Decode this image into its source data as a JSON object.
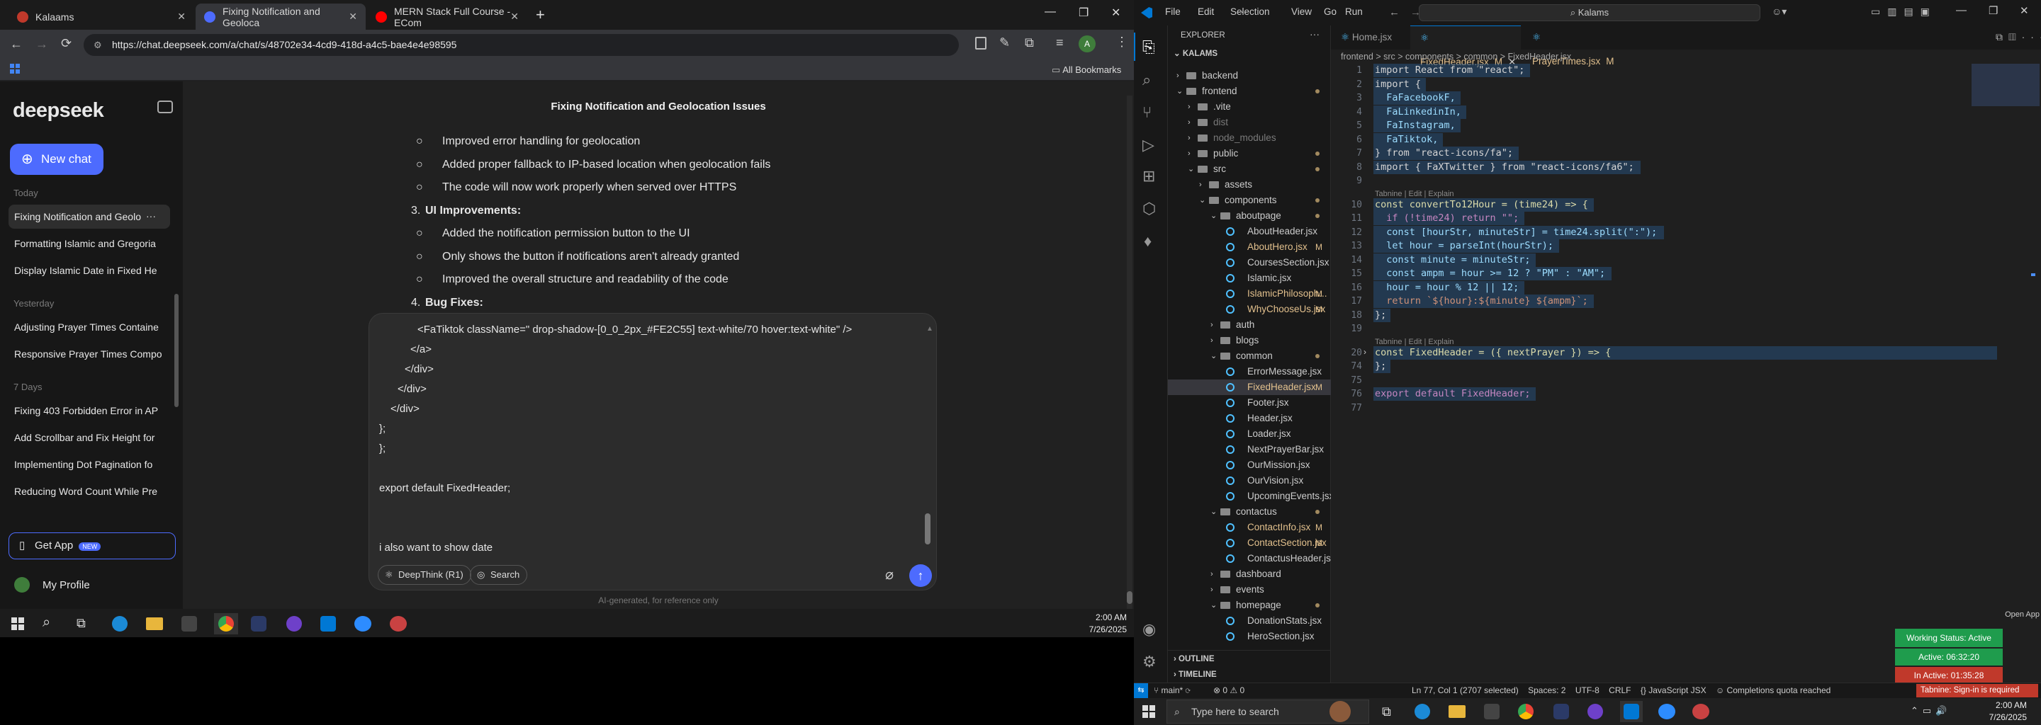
{
  "browser": {
    "tabs": [
      {
        "title": "Kalaams",
        "color": "#c0392b"
      },
      {
        "title": "Fixing Notification and Geoloca",
        "color": "#4d6bfe"
      },
      {
        "title": "MERN Stack Full Course - ECom",
        "color": "#ff0000"
      }
    ],
    "url": "https://chat.deepseek.com/a/chat/s/48702e34-4cd9-418d-a4c5-bae4e4e98595",
    "bookmarks_label": "All Bookmarks"
  },
  "deepseek": {
    "logo": "deepseek",
    "new_chat": "New chat",
    "groups": [
      {
        "label": "Today",
        "items": [
          "Fixing Notification and Geolo",
          "Formatting Islamic and Gregoria",
          "Display Islamic Date in Fixed He"
        ]
      },
      {
        "label": "Yesterday",
        "items": [
          "Adjusting Prayer Times Containe",
          "Responsive Prayer Times Compo"
        ]
      },
      {
        "label": "7 Days",
        "items": [
          "Fixing 403 Forbidden Error in AP",
          "Add Scrollbar and Fix Height for",
          "Implementing Dot Pagination fo",
          "Reducing Word Count While Pre"
        ]
      }
    ],
    "get_app": "Get App",
    "new_badge": "NEW",
    "profile": "My Profile",
    "chat_title": "Fixing Notification and Geolocation Issues",
    "message_lines": [
      {
        "type": "bullet",
        "text": "Improved error handling for geolocation"
      },
      {
        "type": "bullet",
        "text": "Added proper fallback to IP-based location when geolocation fails"
      },
      {
        "type": "bullet",
        "text": "The code will now work properly when served over HTTPS"
      },
      {
        "type": "num",
        "num": "3.",
        "text": "UI Improvements:"
      },
      {
        "type": "bullet",
        "text": "Added the notification permission button to the UI"
      },
      {
        "type": "bullet",
        "text": "Only shows the button if notifications aren't already granted"
      },
      {
        "type": "bullet",
        "text": "Improved the overall structure and readability of the code"
      },
      {
        "type": "num",
        "num": "4.",
        "text": "Bug Fixes:"
      }
    ],
    "input_lines": [
      "<FaTiktok className=\" drop-shadow-[0_0_2px_#FE2C55] text-white/70 hover:text-white\" />",
      "</a>",
      "</div>",
      "</div>",
      "</div>",
      "};",
      "};",
      "",
      "export default FixedHeader;",
      "",
      "",
      "i also want to show date"
    ],
    "deepthink": "DeepThink (R1)",
    "search": "Search",
    "disclaimer": "AI-generated, for reference only"
  },
  "taskbar1": {
    "time": "2:00 AM",
    "date": "7/26/2025"
  },
  "vscode": {
    "menu": [
      "File",
      "Edit",
      "Selection",
      "View",
      "Go",
      "Run"
    ],
    "search": "Kalams",
    "explorer_title": "EXPLORER",
    "root": "KALAMS",
    "tree": [
      {
        "name": "backend",
        "kind": "folder-closed",
        "depth": 0
      },
      {
        "name": "frontend",
        "kind": "folder-open",
        "depth": 0,
        "dot": true
      },
      {
        "name": ".vite",
        "kind": "folder-closed",
        "depth": 1
      },
      {
        "name": "dist",
        "kind": "folder-closed",
        "depth": 1,
        "dim": true
      },
      {
        "name": "node_modules",
        "kind": "folder-closed",
        "depth": 1,
        "dim": true
      },
      {
        "name": "public",
        "kind": "folder-closed",
        "depth": 1,
        "dot": true
      },
      {
        "name": "src",
        "kind": "folder-open",
        "depth": 1,
        "dot": true
      },
      {
        "name": "assets",
        "kind": "folder-closed",
        "depth": 2
      },
      {
        "name": "components",
        "kind": "folder-open",
        "depth": 2,
        "dot": true
      },
      {
        "name": "aboutpage",
        "kind": "folder-open",
        "depth": 3,
        "dot": true
      },
      {
        "name": "AboutHeader.jsx",
        "kind": "file",
        "depth": 4
      },
      {
        "name": "AboutHero.jsx",
        "kind": "file",
        "depth": 4,
        "badge": "M"
      },
      {
        "name": "CoursesSection.jsx",
        "kind": "file",
        "depth": 4
      },
      {
        "name": "Islamic.jsx",
        "kind": "file",
        "depth": 4
      },
      {
        "name": "IslamicPhilosoph...",
        "kind": "file",
        "depth": 4,
        "badge": "M"
      },
      {
        "name": "WhyChooseUs.jsx",
        "kind": "file",
        "depth": 4,
        "badge": "M"
      },
      {
        "name": "auth",
        "kind": "folder-closed",
        "depth": 3
      },
      {
        "name": "blogs",
        "kind": "folder-closed",
        "depth": 3
      },
      {
        "name": "common",
        "kind": "folder-open",
        "depth": 3,
        "dot": true
      },
      {
        "name": "ErrorMessage.jsx",
        "kind": "file",
        "depth": 4
      },
      {
        "name": "FixedHeader.jsx",
        "kind": "file",
        "depth": 4,
        "badge": "M",
        "selected": true
      },
      {
        "name": "Footer.jsx",
        "kind": "file",
        "depth": 4
      },
      {
        "name": "Header.jsx",
        "kind": "file",
        "depth": 4
      },
      {
        "name": "Loader.jsx",
        "kind": "file",
        "depth": 4
      },
      {
        "name": "NextPrayerBar.jsx",
        "kind": "file",
        "depth": 4
      },
      {
        "name": "OurMission.jsx",
        "kind": "file",
        "depth": 4
      },
      {
        "name": "OurVision.jsx",
        "kind": "file",
        "depth": 4
      },
      {
        "name": "UpcomingEvents.jsx",
        "kind": "file",
        "depth": 4
      },
      {
        "name": "contactus",
        "kind": "folder-open",
        "depth": 3,
        "dot": true
      },
      {
        "name": "ContactInfo.jsx",
        "kind": "file",
        "depth": 4,
        "badge": "M"
      },
      {
        "name": "ContactSection.jsx",
        "kind": "file",
        "depth": 4,
        "badge": "M"
      },
      {
        "name": "ContactusHeader.jsx",
        "kind": "file",
        "depth": 4
      },
      {
        "name": "dashboard",
        "kind": "folder-closed",
        "depth": 3
      },
      {
        "name": "events",
        "kind": "folder-closed",
        "depth": 3
      },
      {
        "name": "homepage",
        "kind": "folder-open",
        "depth": 3,
        "dot": true
      },
      {
        "name": "DonationStats.jsx",
        "kind": "file",
        "depth": 4
      },
      {
        "name": "HeroSection.jsx",
        "kind": "file",
        "depth": 4
      }
    ],
    "outline": "OUTLINE",
    "timeline": "TIMELINE",
    "editor_tabs": [
      {
        "name": "Home.jsx",
        "active": false
      },
      {
        "name": "FixedHeader.jsx",
        "active": true,
        "badge": "M"
      },
      {
        "name": "PrayerTimes.jsx",
        "active": false,
        "badge": "M"
      }
    ],
    "breadcrumb": "frontend > src > components > common > FixedHeader.jsx",
    "code": [
      {
        "n": "1",
        "t": "import React from \"react\";",
        "c": "#d4d4d4"
      },
      {
        "n": "2",
        "t": "import {",
        "c": "#d4d4d4"
      },
      {
        "n": "3",
        "t": "  FaFacebookF,",
        "c": "#9cdcfe"
      },
      {
        "n": "4",
        "t": "  FaLinkedinIn,",
        "c": "#9cdcfe"
      },
      {
        "n": "5",
        "t": "  FaInstagram,",
        "c": "#9cdcfe"
      },
      {
        "n": "6",
        "t": "  FaTiktok,",
        "c": "#9cdcfe"
      },
      {
        "n": "7",
        "t": "} from \"react-icons/fa\";",
        "c": "#d4d4d4"
      },
      {
        "n": "8",
        "t": "import { FaXTwitter } from \"react-icons/fa6\";",
        "c": "#d4d4d4"
      },
      {
        "n": "9",
        "t": "",
        "c": "#d4d4d4"
      },
      {
        "n": "",
        "t": "Tabnine | Edit | Explain",
        "c": "#8b8b8b",
        "lens": true
      },
      {
        "n": "10",
        "t": "const convertTo12Hour = (time24) => {",
        "c": "#dcdcaa"
      },
      {
        "n": "11",
        "t": "  if (!time24) return \"\";",
        "c": "#c586c0"
      },
      {
        "n": "12",
        "t": "  const [hourStr, minuteStr] = time24.split(\":\");",
        "c": "#9cdcfe"
      },
      {
        "n": "13",
        "t": "  let hour = parseInt(hourStr);",
        "c": "#9cdcfe"
      },
      {
        "n": "14",
        "t": "  const minute = minuteStr;",
        "c": "#9cdcfe"
      },
      {
        "n": "15",
        "t": "  const ampm = hour >= 12 ? \"PM\" : \"AM\";",
        "c": "#9cdcfe"
      },
      {
        "n": "16",
        "t": "  hour = hour % 12 || 12;",
        "c": "#9cdcfe"
      },
      {
        "n": "17",
        "t": "  return `${hour}:${minute} ${ampm}`;",
        "c": "#ce9178"
      },
      {
        "n": "18",
        "t": "};",
        "c": "#d4d4d4"
      },
      {
        "n": "19",
        "t": "",
        "c": "#d4d4d4"
      },
      {
        "n": "",
        "t": "Tabnine | Edit | Explain",
        "c": "#8b8b8b",
        "lens": true
      },
      {
        "n": "20",
        "t": "const FixedHeader = ({ nextPrayer }) => {",
        "c": "#dcdcaa",
        "fold": true
      },
      {
        "n": "74",
        "t": "};",
        "c": "#d4d4d4"
      },
      {
        "n": "75",
        "t": "",
        "c": "#d4d4d4"
      },
      {
        "n": "76",
        "t": "export default FixedHeader;",
        "c": "#c586c0"
      },
      {
        "n": "77",
        "t": "",
        "c": "#d4d4d4"
      }
    ],
    "right_panel": {
      "label": "Open App",
      "working": "Working Status: Active",
      "active": "Active: 06:32:20",
      "inactive": "In Active: 01:35:28"
    },
    "status": {
      "branch": "main*",
      "errors": "0",
      "warnings": "0",
      "position": "Ln 77, Col 1 (2707 selected)",
      "spaces": "Spaces: 2",
      "encoding": "UTF-8",
      "eol": "CRLF",
      "language": "JavaScript JSX",
      "quota": "Completions quota reached",
      "tabnine": "Tabnine: Sign-in is required"
    }
  },
  "taskbar2": {
    "search": "Type here to search",
    "time": "2:00 AM",
    "date": "7/26/2025"
  }
}
